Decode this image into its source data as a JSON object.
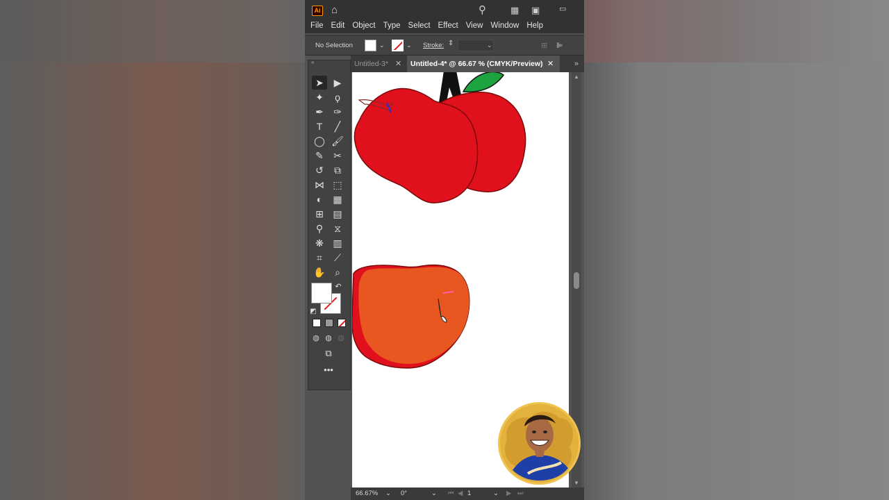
{
  "app": {
    "logo": "Ai",
    "menu": [
      "File",
      "Edit",
      "Object",
      "Type",
      "Select",
      "Effect",
      "View",
      "Window",
      "Help"
    ]
  },
  "control_bar": {
    "selection_label": "No Selection",
    "stroke_label": "Stroke:"
  },
  "tabs": [
    {
      "label": "Untitled-3*",
      "active": false
    },
    {
      "label": "Untitled-4* @ 66.67 % (CMYK/Preview)",
      "active": true
    }
  ],
  "tools": [
    {
      "name": "selection-tool-icon",
      "glyph": "➤"
    },
    {
      "name": "direct-selection-tool-icon",
      "glyph": "▶"
    },
    {
      "name": "magic-wand-tool-icon",
      "glyph": "✦"
    },
    {
      "name": "lasso-tool-icon",
      "glyph": "ϙ"
    },
    {
      "name": "pen-tool-icon",
      "glyph": "✒"
    },
    {
      "name": "curvature-tool-icon",
      "glyph": "✑"
    },
    {
      "name": "type-tool-icon",
      "glyph": "T"
    },
    {
      "name": "line-segment-tool-icon",
      "glyph": "╱"
    },
    {
      "name": "ellipse-tool-icon",
      "glyph": "◯"
    },
    {
      "name": "paintbrush-tool-icon",
      "glyph": "🖌"
    },
    {
      "name": "pencil-tool-icon",
      "glyph": "✎"
    },
    {
      "name": "scissors-tool-icon",
      "glyph": "✂"
    },
    {
      "name": "rotate-tool-icon",
      "glyph": "↺"
    },
    {
      "name": "scale-tool-icon",
      "glyph": "⧉"
    },
    {
      "name": "width-tool-icon",
      "glyph": "⋈"
    },
    {
      "name": "free-transform-tool-icon",
      "glyph": "⬚"
    },
    {
      "name": "shape-builder-tool-icon",
      "glyph": "◐"
    },
    {
      "name": "perspective-grid-tool-icon",
      "glyph": "▦"
    },
    {
      "name": "mesh-tool-icon",
      "glyph": "⊞"
    },
    {
      "name": "gradient-tool-icon",
      "glyph": "▤"
    },
    {
      "name": "eyedropper-tool-icon",
      "glyph": "⚲"
    },
    {
      "name": "blend-tool-icon",
      "glyph": "⧖"
    },
    {
      "name": "symbol-sprayer-tool-icon",
      "glyph": "❋"
    },
    {
      "name": "column-graph-tool-icon",
      "glyph": "▥"
    },
    {
      "name": "artboard-tool-icon",
      "glyph": "⌗"
    },
    {
      "name": "slice-tool-icon",
      "glyph": "⟋"
    },
    {
      "name": "hand-tool-icon",
      "glyph": "✋"
    },
    {
      "name": "zoom-tool-icon",
      "glyph": "⌕"
    }
  ],
  "status": {
    "zoom": "66.67%",
    "rotation": "0°",
    "artboard_number": "1"
  },
  "colors": {
    "apple_red": "#e0101c",
    "apple_orange": "#e8571f",
    "leaf_green": "#1ea341",
    "stem": "#111111"
  }
}
